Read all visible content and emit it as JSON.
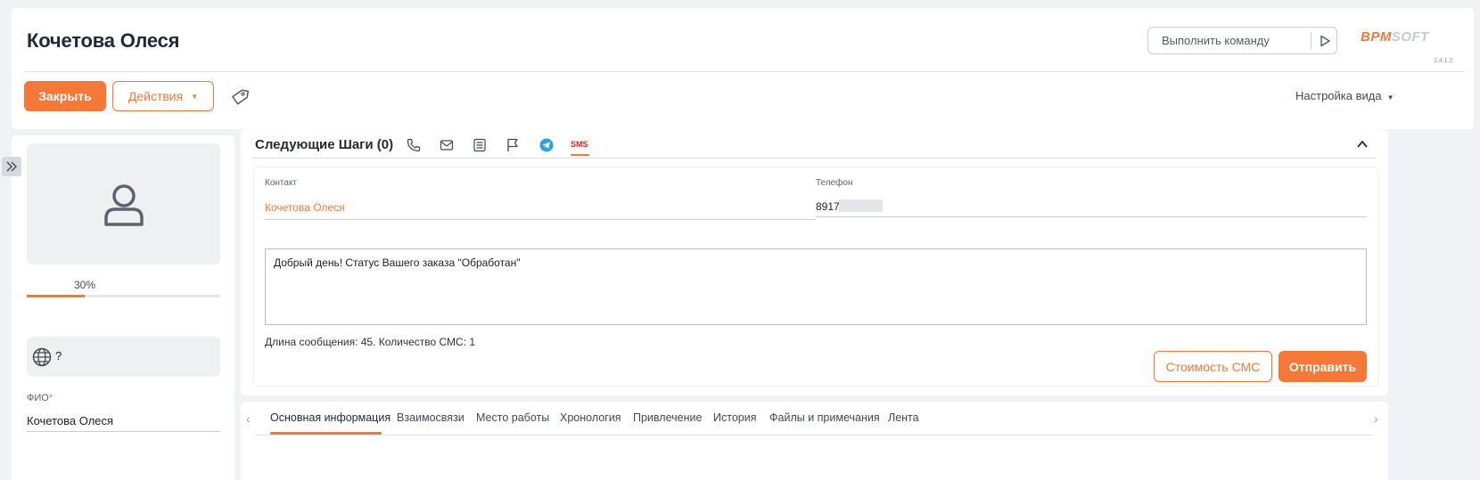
{
  "header": {
    "title": "Кочетова Олеся",
    "command_placeholder": "Выполнить команду",
    "logo_bpm": "BPM",
    "logo_soft": "SOFT",
    "version": "1.4.1.2",
    "close_label": "Закрыть",
    "actions_label": "Действия",
    "view_settings_label": "Настройка вида"
  },
  "profile": {
    "progress_label": "30%",
    "progress_value": 0.3,
    "language_value": "?",
    "fio_label": "ФИО",
    "fio_required_mark": "*",
    "fio_value": "Кочетова Олеся"
  },
  "next_steps": {
    "title": "Следующие Шаги (0)",
    "icons": [
      "phone-icon",
      "email-icon",
      "task-icon",
      "flag-icon",
      "telegram-icon"
    ],
    "sms_tab_label": "SMS",
    "contact_label": "Контакт",
    "contact_value": "Кочетова Олеся",
    "phone_label": "Телефон",
    "phone_value": "89170",
    "message_text": "Добрый день! Статус Вашего заказа \"Обработан\"",
    "message_info": "Длина сообщения: 45. Количество СМС: 1",
    "sms_cost_label": "Стоимость СМС",
    "send_label": "Отправить"
  },
  "tabs": [
    {
      "label": "Основная информация",
      "active": true
    },
    {
      "label": "Взаимосвязи"
    },
    {
      "label": "Место работы"
    },
    {
      "label": "Хронология"
    },
    {
      "label": "Привлечение"
    },
    {
      "label": "История"
    },
    {
      "label": "Файлы и примечания"
    },
    {
      "label": "Лента"
    }
  ],
  "colors": {
    "accent": "#f47838",
    "telegram": "#2aa3df",
    "sms": "#e02020"
  }
}
